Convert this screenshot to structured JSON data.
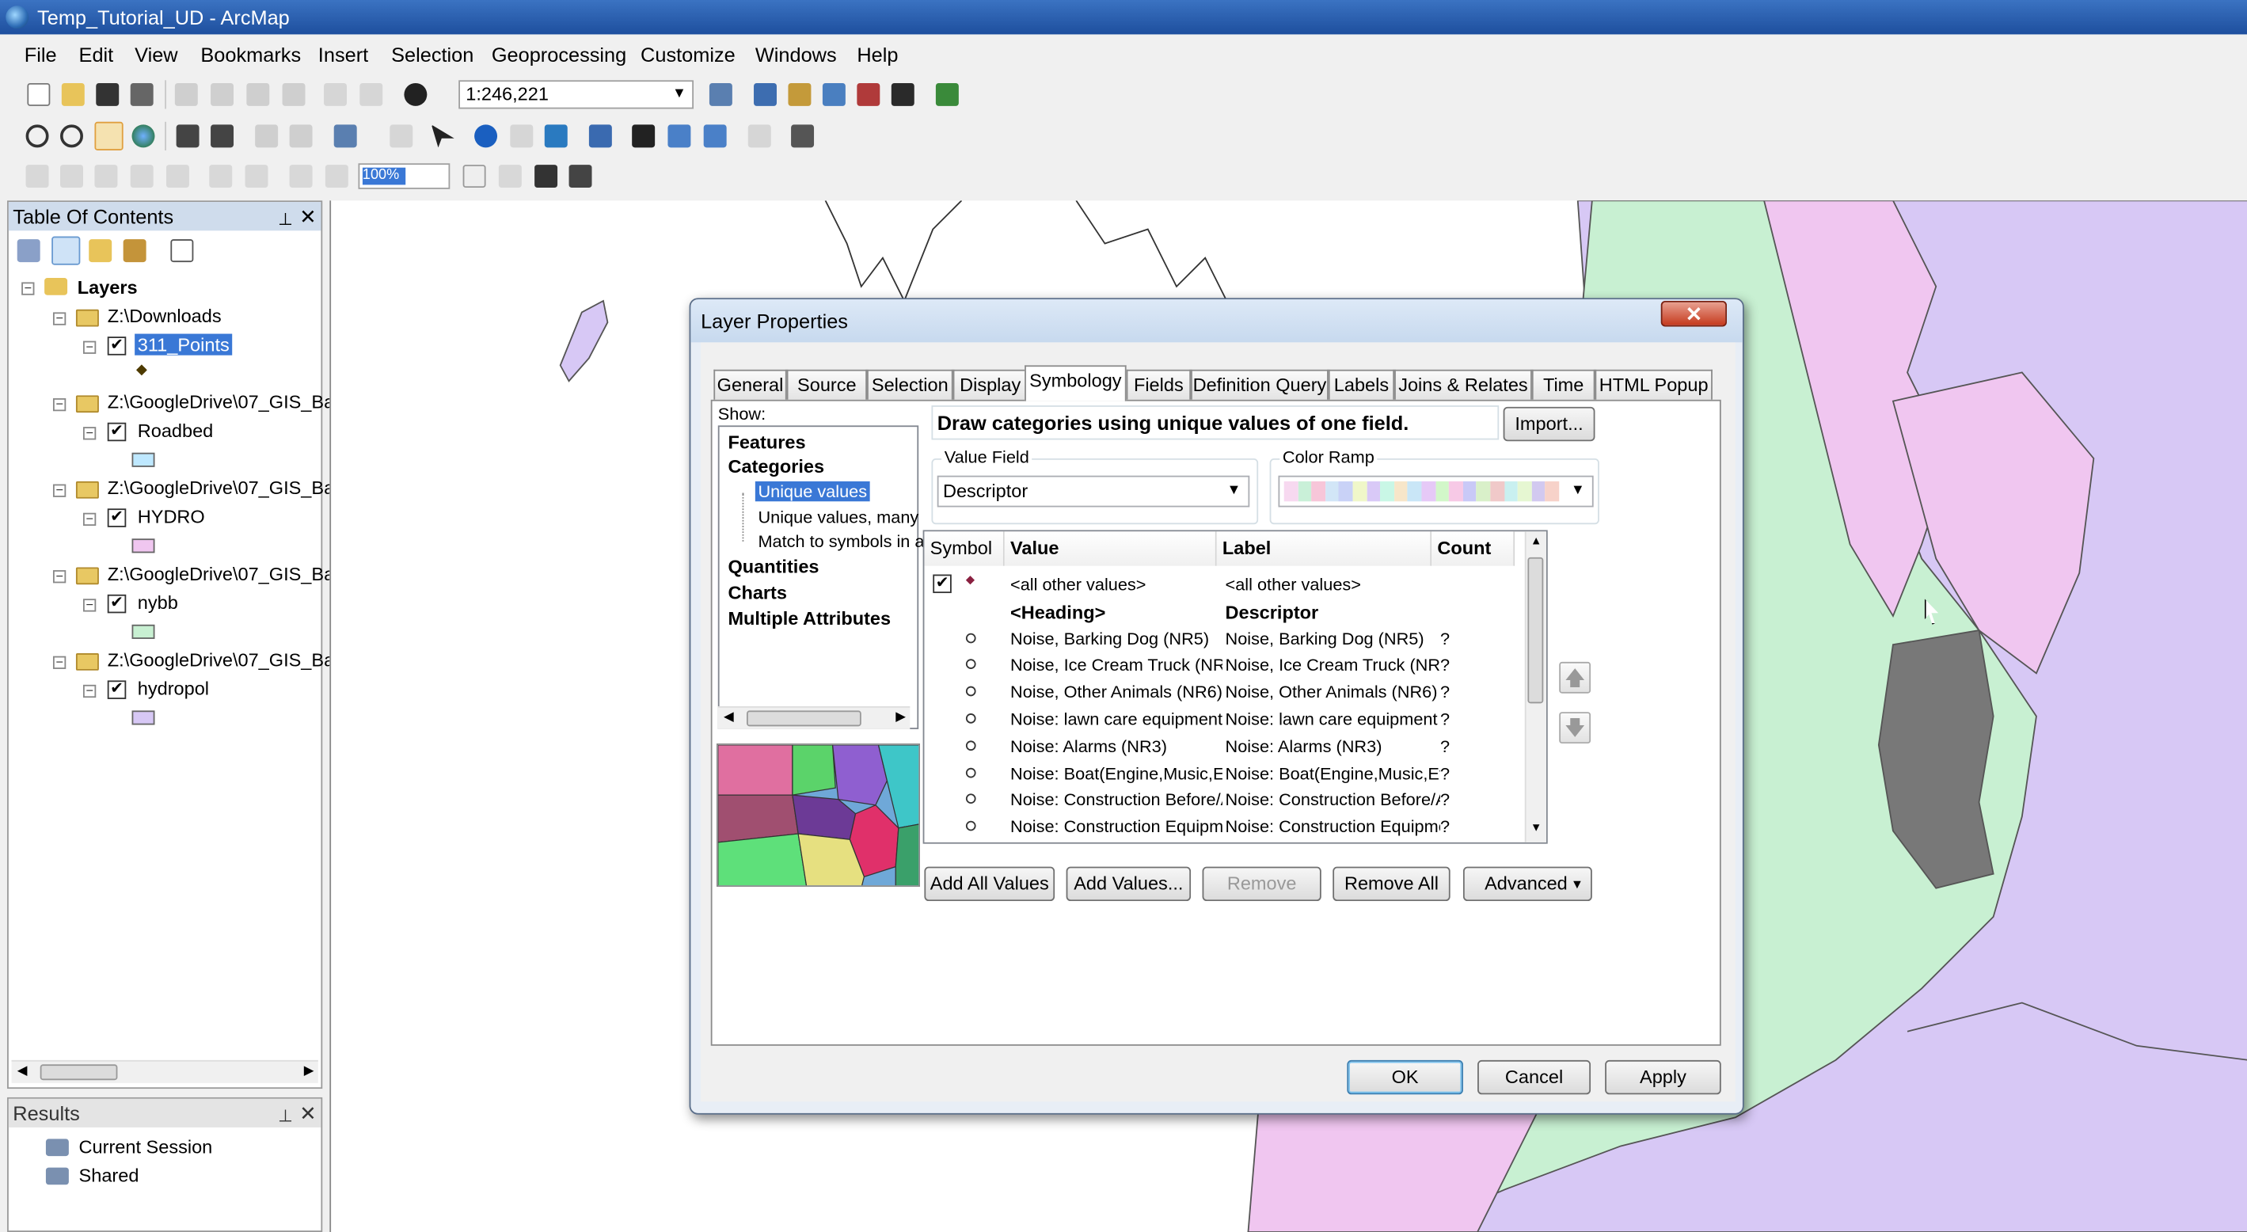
{
  "window": {
    "title": "Temp_Tutorial_UD - ArcMap"
  },
  "menus": [
    "File",
    "Edit",
    "View",
    "Bookmarks",
    "Insert",
    "Selection",
    "Geoprocessing",
    "Customize",
    "Windows",
    "Help"
  ],
  "toolbar": {
    "scale": "1:246,221",
    "zoom_percent": "100%"
  },
  "toc": {
    "title": "Table Of Contents",
    "root": "Layers",
    "groups": [
      {
        "folder": "Z:\\Downloads",
        "layer": "311_Points",
        "checked": true,
        "symbol_color": "#4d3a00"
      },
      {
        "folder": "Z:\\GoogleDrive\\07_GIS_Ba",
        "layer": "Roadbed",
        "checked": true,
        "symbol_color": "#bee8ff"
      },
      {
        "folder": "Z:\\GoogleDrive\\07_GIS_Ba",
        "layer": "HYDRO",
        "checked": true,
        "symbol_color": "#f0c6f0"
      },
      {
        "folder": "Z:\\GoogleDrive\\07_GIS_Ba",
        "layer": "nybb",
        "checked": true,
        "symbol_color": "#c8f0d2"
      },
      {
        "folder": "Z:\\GoogleDrive\\07_GIS_Ba",
        "layer": "hydropol",
        "checked": true,
        "symbol_color": "#d7c8f5"
      }
    ]
  },
  "results": {
    "title": "Results",
    "items": [
      "Current Session",
      "Shared"
    ]
  },
  "dialog": {
    "title": "Layer Properties",
    "close": "✕",
    "tabs": [
      "General",
      "Source",
      "Selection",
      "Display",
      "Symbology",
      "Fields",
      "Definition Query",
      "Labels",
      "Joins & Relates",
      "Time",
      "HTML Popup"
    ],
    "active_tab": "Symbology",
    "show_label": "Show:",
    "show_items": {
      "features": "Features",
      "categories": "Categories",
      "sub": [
        "Unique values",
        "Unique values, many",
        "Match to symbols in a"
      ],
      "quantities": "Quantities",
      "charts": "Charts",
      "multiple": "Multiple Attributes"
    },
    "description": "Draw categories using unique values of one field.",
    "import_button": "Import...",
    "value_field_label": "Value Field",
    "value_field": "Descriptor",
    "color_ramp_label": "Color Ramp",
    "color_ramp": [
      "#f7d9f0",
      "#c9f0d8",
      "#f7c6d9",
      "#d2e6f7",
      "#c9d2f7",
      "#f0f7c9",
      "#d9c9f7",
      "#c9f7e6",
      "#f7e6c9",
      "#c9e6f7",
      "#e6c9f7",
      "#d2f7c9",
      "#f7c9e6",
      "#c9c9f7",
      "#d9f0c9",
      "#f0c9c9",
      "#c9f0f0",
      "#e6f7d2",
      "#d2c9f0",
      "#f7d2c9"
    ],
    "grid": {
      "headers": [
        "Symbol",
        "Value",
        "Label",
        "Count"
      ],
      "rows": [
        {
          "value": "<all other values>",
          "label": "<all other values>",
          "count": "",
          "type": "all"
        },
        {
          "value": "<Heading>",
          "label": "Descriptor",
          "count": "",
          "type": "heading"
        },
        {
          "value": "Noise, Barking Dog (NR5)",
          "label": "Noise, Barking Dog (NR5)",
          "count": "?",
          "type": "item"
        },
        {
          "value": "Noise, Ice Cream Truck (NR",
          "label": "Noise, Ice Cream Truck (NR",
          "count": "?",
          "type": "item"
        },
        {
          "value": "Noise, Other Animals (NR6)",
          "label": "Noise, Other Animals (NR6)",
          "count": "?",
          "type": "item"
        },
        {
          "value": "Noise:  lawn care equipment",
          "label": "Noise:  lawn care equipment",
          "count": "?",
          "type": "item"
        },
        {
          "value": "Noise: Alarms (NR3)",
          "label": "Noise: Alarms (NR3)",
          "count": "?",
          "type": "item"
        },
        {
          "value": "Noise: Boat(Engine,Music,Et",
          "label": "Noise: Boat(Engine,Music,Et",
          "count": "?",
          "type": "item"
        },
        {
          "value": "Noise: Construction Before/A",
          "label": "Noise: Construction Before/A",
          "count": "?",
          "type": "item"
        },
        {
          "value": "Noise: Construction Equipme",
          "label": "Noise: Construction Equipme",
          "count": "?",
          "type": "item"
        }
      ]
    },
    "buttons": {
      "add_all": "Add All Values",
      "add_values": "Add Values...",
      "remove": "Remove",
      "remove_all": "Remove All",
      "advanced": "Advanced"
    },
    "footer": {
      "ok": "OK",
      "cancel": "Cancel",
      "apply": "Apply"
    }
  },
  "map_colors": {
    "land_green": "#c8f0d2",
    "pink": "#f0c6f0",
    "purple": "#d7c8f5",
    "dense": "#787878"
  }
}
